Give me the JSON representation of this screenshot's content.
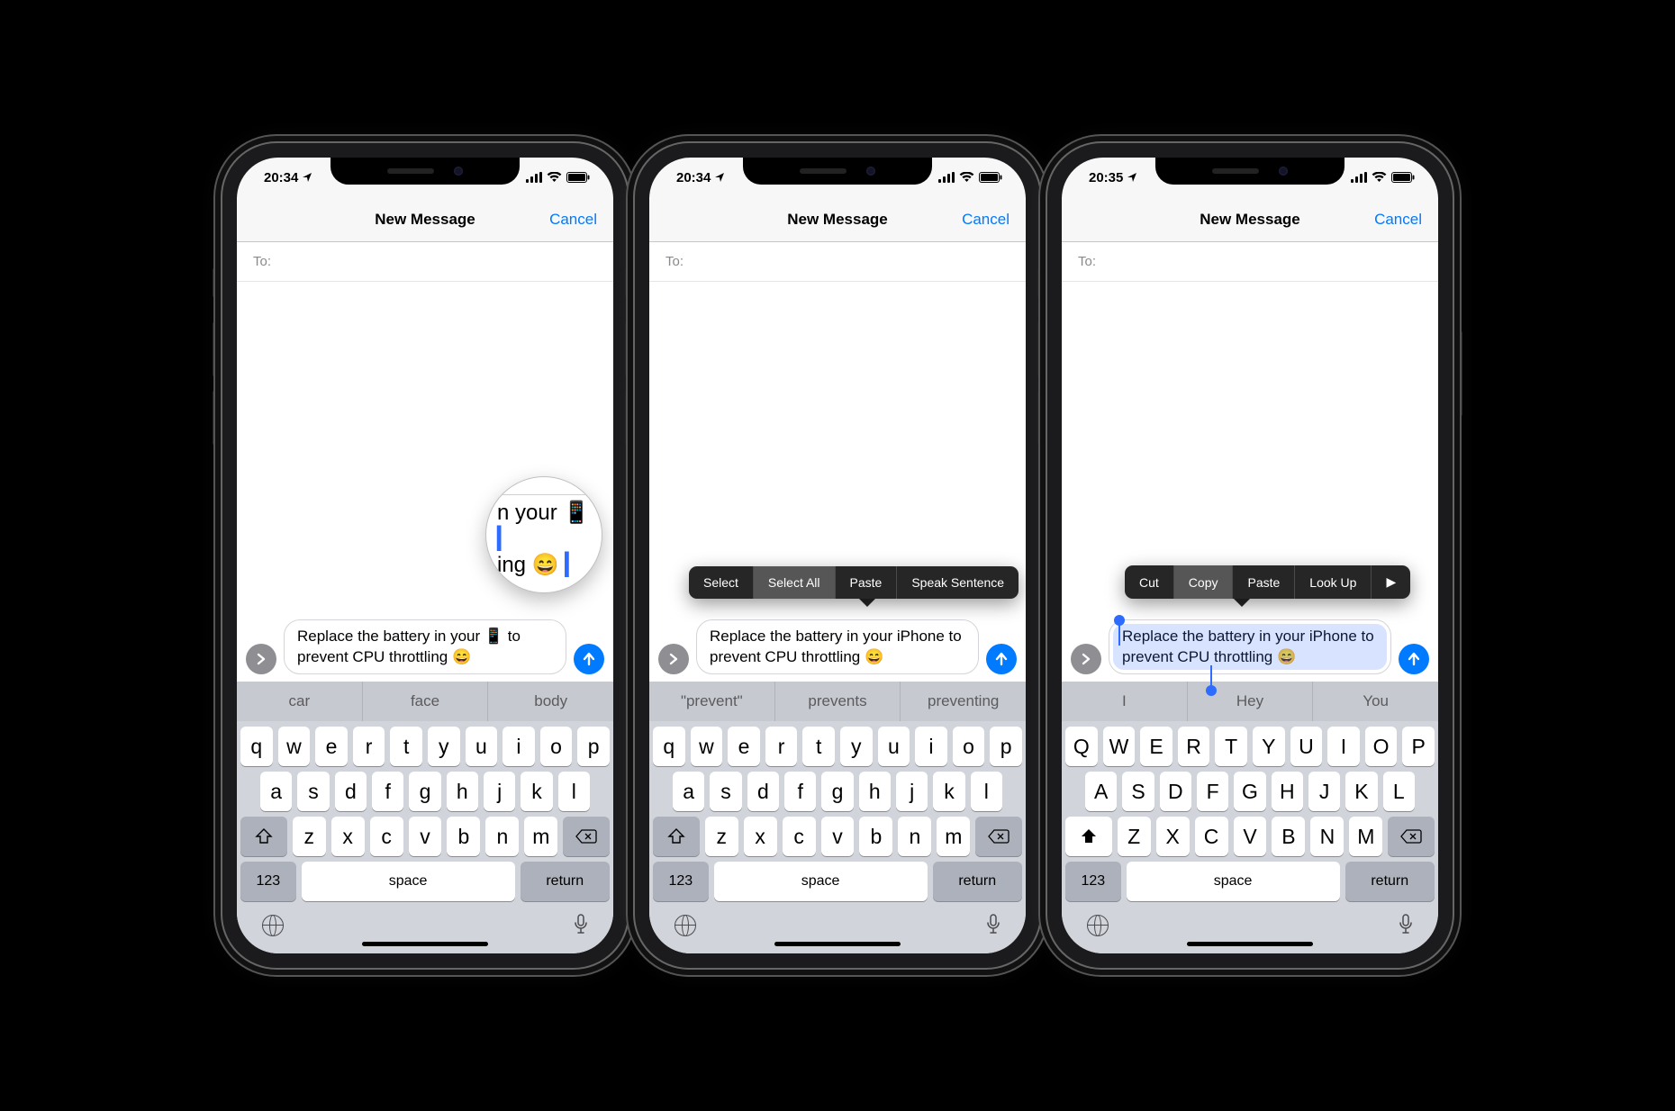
{
  "phones": [
    {
      "time": "20:34",
      "title": "New Message",
      "cancel": "Cancel",
      "to_label": "To:",
      "message": "Replace the battery in your 📱 to prevent CPU throttling 😄",
      "loupe": {
        "line1": "n your 📱",
        "line2": "ing 😄"
      },
      "predictions": [
        "car",
        "face",
        "body"
      ],
      "rows": [
        [
          "q",
          "w",
          "e",
          "r",
          "t",
          "y",
          "u",
          "i",
          "o",
          "p"
        ],
        [
          "a",
          "s",
          "d",
          "f",
          "g",
          "h",
          "j",
          "k",
          "l"
        ],
        [
          "z",
          "x",
          "c",
          "v",
          "b",
          "n",
          "m"
        ]
      ],
      "numkey": "123",
      "space": "space",
      "return": "return"
    },
    {
      "time": "20:34",
      "title": "New Message",
      "cancel": "Cancel",
      "to_label": "To:",
      "message": "Replace the battery in your iPhone to prevent CPU throttling 😄",
      "menu": [
        "Select",
        "Select All",
        "Paste",
        "Speak Sentence"
      ],
      "menu_highlight": 1,
      "predictions": [
        "\"prevent\"",
        "prevents",
        "preventing"
      ],
      "rows": [
        [
          "q",
          "w",
          "e",
          "r",
          "t",
          "y",
          "u",
          "i",
          "o",
          "p"
        ],
        [
          "a",
          "s",
          "d",
          "f",
          "g",
          "h",
          "j",
          "k",
          "l"
        ],
        [
          "z",
          "x",
          "c",
          "v",
          "b",
          "n",
          "m"
        ]
      ],
      "numkey": "123",
      "space": "space",
      "return": "return"
    },
    {
      "time": "20:35",
      "title": "New Message",
      "cancel": "Cancel",
      "to_label": "To:",
      "message": "Replace the battery in your iPhone to prevent CPU throttling 😄",
      "menu": [
        "Cut",
        "Copy",
        "Paste",
        "Look Up",
        "▶"
      ],
      "menu_highlight": 1,
      "selected": true,
      "predictions": [
        "I",
        "Hey",
        "You"
      ],
      "rows": [
        [
          "Q",
          "W",
          "E",
          "R",
          "T",
          "Y",
          "U",
          "I",
          "O",
          "P"
        ],
        [
          "A",
          "S",
          "D",
          "F",
          "G",
          "H",
          "J",
          "K",
          "L"
        ],
        [
          "Z",
          "X",
          "C",
          "V",
          "B",
          "N",
          "M"
        ]
      ],
      "shift_active": true,
      "numkey": "123",
      "space": "space",
      "return": "return"
    }
  ]
}
